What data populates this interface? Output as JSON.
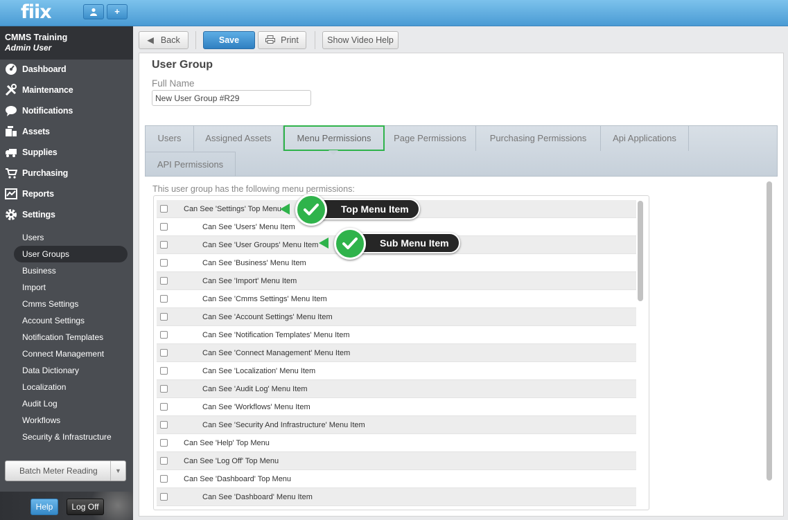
{
  "app": {
    "logo": "fiix"
  },
  "topbar": {
    "user_btn_icon": "user-icon",
    "add_btn_label": "+"
  },
  "sidebar": {
    "org_name": "CMMS Training",
    "user_name": "Admin User",
    "nav": [
      {
        "label": "Dashboard",
        "icon": "dashboard-icon"
      },
      {
        "label": "Maintenance",
        "icon": "tools-icon"
      },
      {
        "label": "Notifications",
        "icon": "speech-bubble-icon"
      },
      {
        "label": "Assets",
        "icon": "boxes-icon"
      },
      {
        "label": "Supplies",
        "icon": "truck-icon"
      },
      {
        "label": "Purchasing",
        "icon": "cart-icon"
      },
      {
        "label": "Reports",
        "icon": "chart-icon"
      },
      {
        "label": "Settings",
        "icon": "gear-icon"
      }
    ],
    "subnav": [
      "Users",
      "User Groups",
      "Business",
      "Import",
      "Cmms Settings",
      "Account Settings",
      "Notification Templates",
      "Connect Management",
      "Data Dictionary",
      "Localization",
      "Audit Log",
      "Workflows",
      "Security & Infrastructure"
    ],
    "subnav_active": "User Groups",
    "batch_button": "Batch Meter Reading",
    "help_button": "Help",
    "logoff_button": "Log Off"
  },
  "toolbar": {
    "back": "Back",
    "save": "Save",
    "print": "Print",
    "video_help": "Show Video Help"
  },
  "form": {
    "title": "User Group",
    "full_name_label": "Full Name",
    "full_name_value": "New User Group #R29"
  },
  "tabs": [
    "Users",
    "Assigned Assets",
    "Menu Permissions",
    "Page Permissions",
    "Purchasing Permissions",
    "Api Applications",
    "API Permissions"
  ],
  "active_tab": "Menu Permissions",
  "permissions": {
    "intro": "This user group has the following menu permissions:",
    "rows": [
      {
        "label": "Can See 'Settings' Top Menu",
        "level": 0
      },
      {
        "label": "Can See 'Users' Menu Item",
        "level": 1
      },
      {
        "label": "Can See 'User Groups' Menu Item",
        "level": 1
      },
      {
        "label": "Can See 'Business' Menu Item",
        "level": 1
      },
      {
        "label": "Can See 'Import' Menu Item",
        "level": 1
      },
      {
        "label": "Can See 'Cmms Settings' Menu Item",
        "level": 1
      },
      {
        "label": "Can See 'Account Settings' Menu Item",
        "level": 1
      },
      {
        "label": "Can See 'Notification Templates' Menu Item",
        "level": 1
      },
      {
        "label": "Can See 'Connect Management' Menu Item",
        "level": 1
      },
      {
        "label": "Can See 'Localization' Menu Item",
        "level": 1
      },
      {
        "label": "Can See 'Audit Log' Menu Item",
        "level": 1
      },
      {
        "label": "Can See 'Workflows' Menu Item",
        "level": 1
      },
      {
        "label": "Can See 'Security And Infrastructure' Menu Item",
        "level": 1
      },
      {
        "label": "Can See 'Help' Top Menu",
        "level": 0
      },
      {
        "label": "Can See 'Log Off' Top Menu",
        "level": 0
      },
      {
        "label": "Can See 'Dashboard' Top Menu",
        "level": 0
      },
      {
        "label": "Can See 'Dashboard' Menu Item",
        "level": 1
      }
    ]
  },
  "callouts": {
    "top_menu": "Top Menu Item",
    "sub_menu": "Sub Menu Item"
  },
  "colors": {
    "accent_green": "#2fb34b",
    "brand_blue": "#4a9bd4",
    "sidebar": "#4a4d52"
  }
}
